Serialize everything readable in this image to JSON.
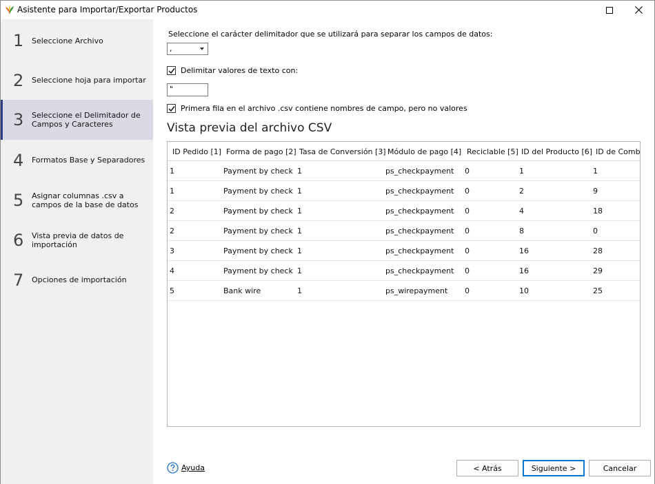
{
  "window": {
    "title": "Asistente para Importar/Exportar Productos"
  },
  "sidebar": {
    "steps": [
      {
        "num": "1",
        "label": "Seleccione Archivo"
      },
      {
        "num": "2",
        "label": "Seleccione hoja para importar"
      },
      {
        "num": "3",
        "label": "Seleccione el Delimitador de Campos y Caracteres",
        "active": true
      },
      {
        "num": "4",
        "label": "Formatos Base y Separadores"
      },
      {
        "num": "5",
        "label": "Asignar columnas .csv a campos de la base de datos"
      },
      {
        "num": "6",
        "label": "Vista previa de datos de importación"
      },
      {
        "num": "7",
        "label": "Opciones de importación"
      }
    ]
  },
  "form": {
    "delimiter_label": "Seleccione el carácter delimitador que se utilizará para separar los campos de datos:",
    "delimiter_value": ",",
    "text_qualifier_label": "Delimitar valores de texto con:",
    "text_qualifier_checked": true,
    "text_qualifier_value": "\"",
    "first_row_label": "Primera fila en el archivo .csv contiene nombres de campo, pero no valores",
    "first_row_checked": true
  },
  "preview": {
    "title": "Vista previa del archivo CSV",
    "columns": [
      "ID Pedido [1]",
      "Forma de pago [2]",
      "Tasa de Conversión [3]",
      "Módulo de pago [4]",
      "Reciclable [5]",
      "ID del Producto [6]",
      "ID de Combi"
    ],
    "rows": [
      [
        "1",
        "Payment by check",
        "1",
        "ps_checkpayment",
        "0",
        "1",
        "1"
      ],
      [
        "1",
        "Payment by check",
        "1",
        "ps_checkpayment",
        "0",
        "2",
        "9"
      ],
      [
        "2",
        "Payment by check",
        "1",
        "ps_checkpayment",
        "0",
        "4",
        "18"
      ],
      [
        "2",
        "Payment by check",
        "1",
        "ps_checkpayment",
        "0",
        "8",
        "0"
      ],
      [
        "3",
        "Payment by check",
        "1",
        "ps_checkpayment",
        "0",
        "16",
        "28"
      ],
      [
        "4",
        "Payment by check",
        "1",
        "ps_checkpayment",
        "0",
        "16",
        "29"
      ],
      [
        "5",
        "Bank wire",
        "1",
        "ps_wirepayment",
        "0",
        "10",
        "25"
      ]
    ]
  },
  "footer": {
    "help_label": "Ayuda",
    "back_label": "< Atrás",
    "next_label": "Siguiente >",
    "cancel_label": "Cancelar"
  },
  "colors": {
    "sidebar_bg": "#f0f0f0",
    "active_step_bg": "#dadae5",
    "accent": "#2e3a86",
    "default_button_border": "#0078d7"
  },
  "icons": {
    "app": "app-logo-icon",
    "maximize": "maximize-icon",
    "close": "close-icon",
    "help": "help-icon",
    "dropdown": "chevron-down-icon",
    "check": "check-icon"
  }
}
